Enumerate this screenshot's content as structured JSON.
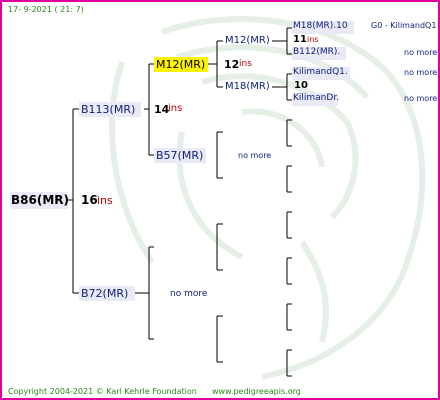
{
  "header": {
    "date": "17-  9-2021  (  21:  7)"
  },
  "footer": {
    "copyright": "Copyright 2004-2021 © Karl Kehrle Foundation",
    "website": "www.pedigreeapis.org"
  },
  "colors": {
    "border": "#e000a0",
    "highlight": "#fff400",
    "name_bg": "#eaeaf6",
    "ins": "#c00000",
    "date": "#2a8a1a"
  },
  "pedigree": {
    "root": {
      "name": "B86(MR)",
      "number": "16",
      "ins": "ins"
    },
    "sire": {
      "name": "B113(MR)",
      "number": "14",
      "ins": "ins"
    },
    "dam": {
      "name": "B72(MR)",
      "note": "no more"
    },
    "sire_sire": {
      "name": "M12(MR)",
      "number": "12",
      "ins": "ins"
    },
    "sire_dam": {
      "name": "B57(MR)",
      "note": "no more"
    },
    "ss_sire": {
      "name": "M12(MR)"
    },
    "ss_dam": {
      "name": "M18(MR)"
    },
    "sss_sire": {
      "name": "M18(MR).10",
      "number": "11",
      "ins": "ins"
    },
    "sss_dam": {
      "name": "B112(MR).",
      "note": "no more"
    },
    "gen5_a": {
      "name": "G0 - KilimandQ1"
    },
    "ssd_sire": {
      "name": "KilimandQ1.",
      "number": "10",
      "note": "no more"
    },
    "ssd_dam": {
      "name": "KilimanDr.",
      "note": "no more"
    }
  }
}
